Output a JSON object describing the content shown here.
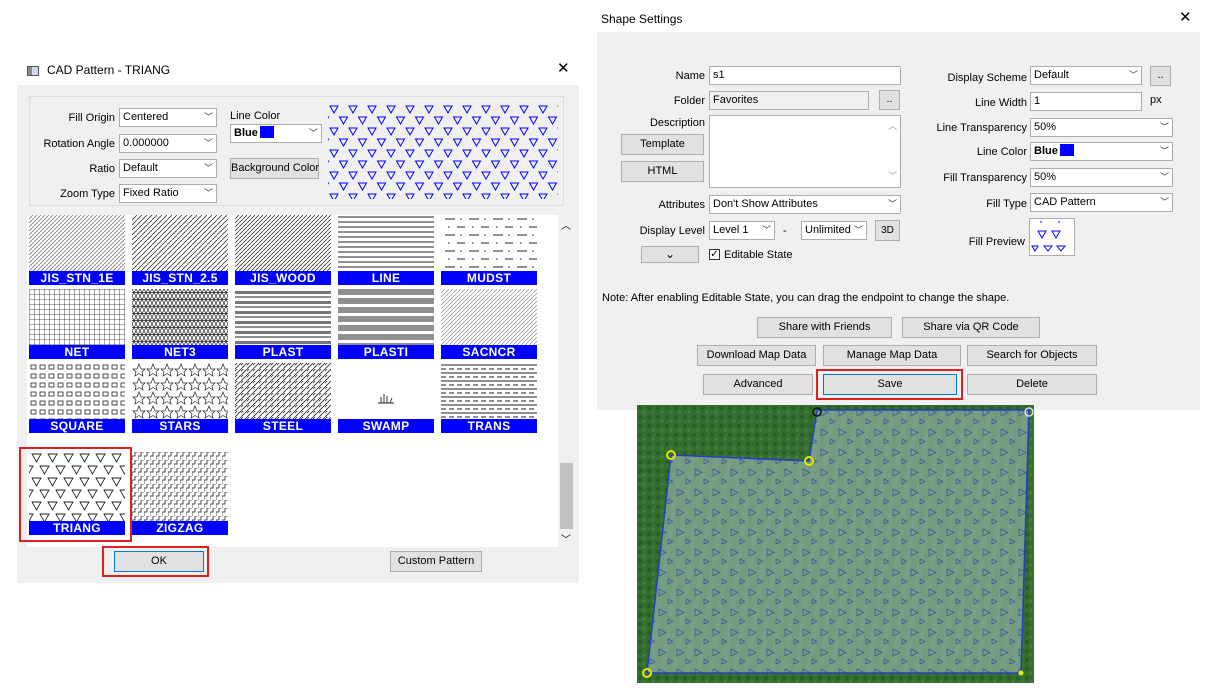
{
  "cad_dialog": {
    "title": "CAD Pattern - TRIANG",
    "fill_origin_label": "Fill Origin",
    "fill_origin_value": "Centered",
    "rotation_angle_label": "Rotation Angle",
    "rotation_angle_value": "0.000000",
    "ratio_label": "Ratio",
    "ratio_value": "Default",
    "zoom_type_label": "Zoom Type",
    "zoom_type_value": "Fixed Ratio",
    "line_color_label": "Line Color",
    "line_color_value": "Blue",
    "background_color_button": "Background Color",
    "ok_button": "OK",
    "custom_pattern_button": "Custom Pattern",
    "patterns": [
      "JIS_STN_1E",
      "JIS_STN_2.5",
      "JIS_WOOD",
      "LINE",
      "MUDST",
      "NET",
      "NET3",
      "PLAST",
      "PLASTI",
      "SACNCR",
      "SQUARE",
      "STARS",
      "STEEL",
      "SWAMP",
      "TRANS",
      "TRIANG",
      "ZIGZAG"
    ],
    "selected_pattern": "TRIANG",
    "pattern_label_color": "#0000ff"
  },
  "shape_dialog": {
    "title": "Shape Settings",
    "name_label": "Name",
    "name_value": "s1",
    "folder_label": "Folder",
    "folder_value": "Favorites",
    "folder_button": "..",
    "description_label": "Description",
    "template_button": "Template",
    "html_button": "HTML",
    "attributes_label": "Attributes",
    "attributes_value": "Don't Show Attributes",
    "display_level_label": "Display Level",
    "display_level_value": "Level 1",
    "display_level_sep": "-",
    "display_level_max": "Unlimited",
    "three_d_button": "3D",
    "editable_state_label": "Editable State",
    "display_scheme_label": "Display Scheme",
    "display_scheme_value": "Default",
    "display_scheme_button": "..",
    "line_width_label": "Line Width",
    "line_width_value": "1",
    "line_width_unit": "px",
    "line_transparency_label": "Line Transparency",
    "line_transparency_value": "50%",
    "line_color_label": "Line Color",
    "line_color_value": "Blue",
    "fill_transparency_label": "Fill Transparency",
    "fill_transparency_value": "50%",
    "fill_type_label": "Fill Type",
    "fill_type_value": "CAD Pattern",
    "fill_preview_label": "Fill Preview",
    "note": "Note: After enabling Editable State, you can drag the endpoint to change the shape.",
    "share_friends_button": "Share with Friends",
    "share_qr_button": "Share via QR Code",
    "download_map_button": "Download Map Data",
    "manage_map_button": "Manage Map Data",
    "search_objects_button": "Search for Objects",
    "advanced_button": "Advanced",
    "save_button": "Save",
    "delete_button": "Delete"
  },
  "colors": {
    "accent_blue": "#0000ff",
    "highlight_red": "#e02020",
    "dialog_bg": "#f0f0f0"
  }
}
